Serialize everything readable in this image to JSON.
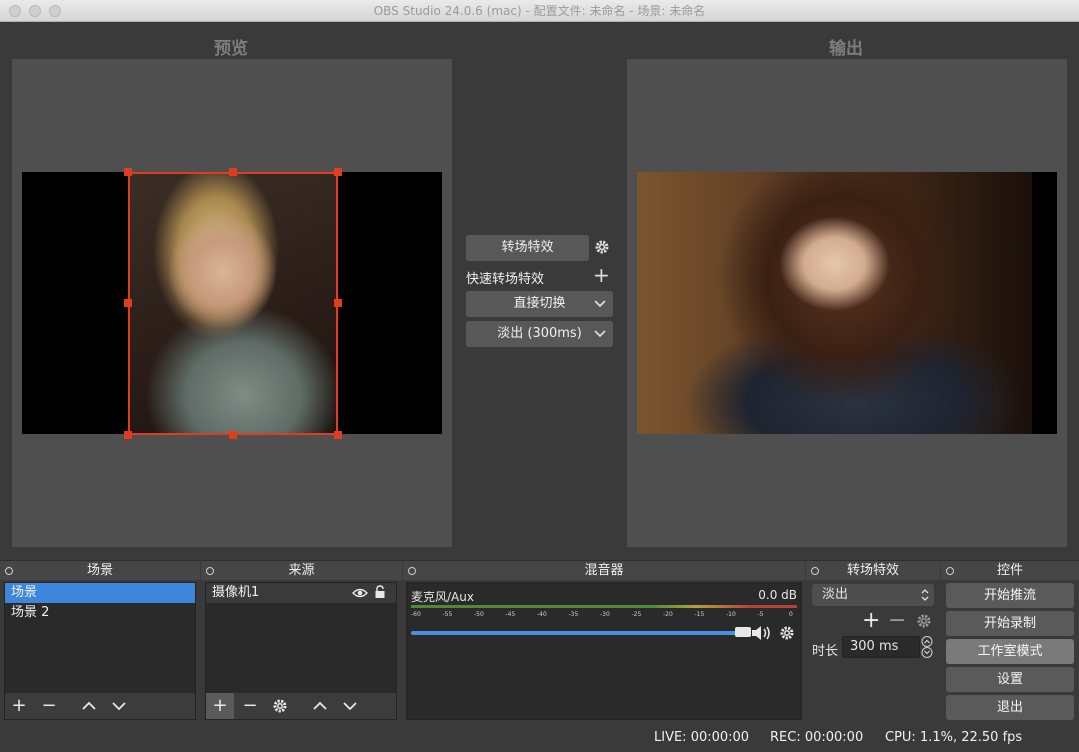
{
  "window": {
    "title": "OBS Studio 24.0.6 (mac) - 配置文件: 未命名 - 场景: 未命名"
  },
  "views": {
    "preview_label": "预览",
    "output_label": "输出"
  },
  "transition_panel": {
    "transition_button": "转场特效",
    "quick_label": "快速转场特效",
    "cut_select": "直接切换",
    "fade_select": "淡出 (300ms)"
  },
  "docks": {
    "scenes": {
      "title": "场景",
      "items": [
        "场景",
        "场景 2"
      ],
      "selected": "场景"
    },
    "sources": {
      "title": "来源",
      "items": [
        "摄像机1"
      ]
    },
    "mixer": {
      "title": "混音器",
      "channel_name": "麦克风/Aux",
      "channel_level": "0.0 dB",
      "ticks": [
        "-60",
        "-55",
        "-50",
        "-45",
        "-40",
        "-35",
        "-30",
        "-25",
        "-20",
        "-15",
        "-10",
        "-5",
        "0"
      ],
      "volume_fraction": 0.97
    },
    "transitions": {
      "title": "转场特效",
      "select_value": "淡出",
      "duration_label": "时长",
      "duration_value": "300 ms"
    },
    "controls": {
      "title": "控件",
      "buttons": [
        "开始推流",
        "开始录制",
        "工作室模式",
        "设置",
        "退出"
      ]
    }
  },
  "status_bar": {
    "live": "LIVE: 00:00:00",
    "rec": "REC: 00:00:00",
    "cpu": "CPU: 1.1%, 22.50 fps"
  },
  "colors": {
    "accent": "#3e86db",
    "selection": "#e03c1f",
    "meter_green": "#4caf50"
  },
  "icons": [
    "gear-icon",
    "plus-icon",
    "minus-icon",
    "chevron-down-icon",
    "chevron-up-icon",
    "eye-icon",
    "lock-icon",
    "speaker-icon"
  ]
}
